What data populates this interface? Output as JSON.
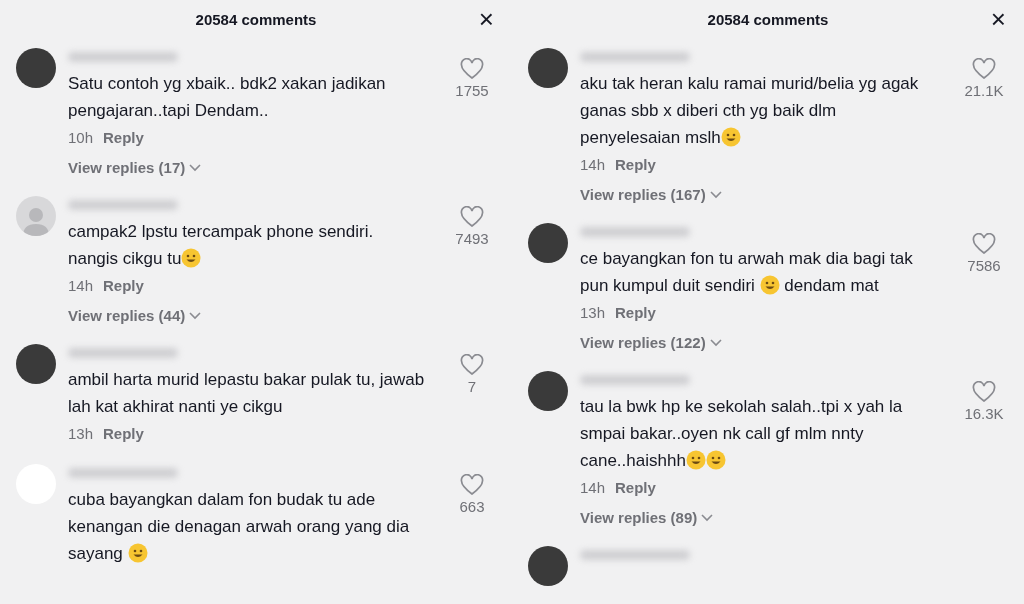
{
  "panels": [
    {
      "title": "20584 comments",
      "close": "×",
      "comments": [
        {
          "avatar": {
            "kind": "photo"
          },
          "text": [
            {
              "kind": "text",
              "text": "Satu contoh yg xbaik.. bdk2 xakan jadikan pengajaran..tapi Dendam.."
            }
          ],
          "time": "10h",
          "reply": "Reply",
          "likes": "1755",
          "replies": "View replies (17)"
        },
        {
          "avatar": {
            "kind": "default"
          },
          "text": [
            {
              "kind": "text",
              "text": "campak2 lpstu tercampak phone sendiri. nangis cikgu tu"
            },
            {
              "kind": "emoji"
            }
          ],
          "time": "14h",
          "reply": "Reply",
          "likes": "7493",
          "replies": "View replies (44)"
        },
        {
          "avatar": {
            "kind": "photo"
          },
          "text": [
            {
              "kind": "text",
              "text": "ambil harta murid lepastu bakar pulak tu, jawab lah kat akhirat nanti ye cikgu"
            }
          ],
          "time": "13h",
          "reply": "Reply",
          "likes": "7"
        },
        {
          "avatar": {
            "kind": "blank"
          },
          "text": [
            {
              "kind": "text",
              "text": "cuba bayangkan dalam fon budak tu ade kenangan die denagan arwah orang yang dia sayang "
            },
            {
              "kind": "emoji"
            }
          ],
          "likes": "663"
        }
      ]
    },
    {
      "title": "20584 comments",
      "close": "×",
      "comments": [
        {
          "avatar": {
            "kind": "photo"
          },
          "text": [
            {
              "kind": "text",
              "text": "aku tak heran kalu ramai murid/belia yg agak ganas sbb x diberi cth yg baik dlm penyelesaian mslh"
            },
            {
              "kind": "emoji"
            }
          ],
          "time": "14h",
          "reply": "Reply",
          "likes": "21.1K",
          "replies": "View replies (167)"
        },
        {
          "avatar": {
            "kind": "photo"
          },
          "text": [
            {
              "kind": "text",
              "text": "ce bayangkan fon tu arwah mak dia bagi tak pun kumpul duit sendiri "
            },
            {
              "kind": "emoji"
            },
            {
              "kind": "text",
              "text": " dendam mat"
            }
          ],
          "time": "13h",
          "reply": "Reply",
          "likes": "7586",
          "replies": "View replies (122)"
        },
        {
          "avatar": {
            "kind": "photo"
          },
          "text": [
            {
              "kind": "text",
              "text": "tau la bwk hp ke sekolah salah..tpi x yah la smpai bakar..oyen nk call gf mlm nnty cane..haishhh"
            },
            {
              "kind": "emoji"
            },
            {
              "kind": "emoji"
            }
          ],
          "time": "14h",
          "reply": "Reply",
          "likes": "16.3K",
          "replies": "View replies (89)"
        },
        {
          "avatar": {
            "kind": "photo"
          }
        }
      ]
    }
  ]
}
